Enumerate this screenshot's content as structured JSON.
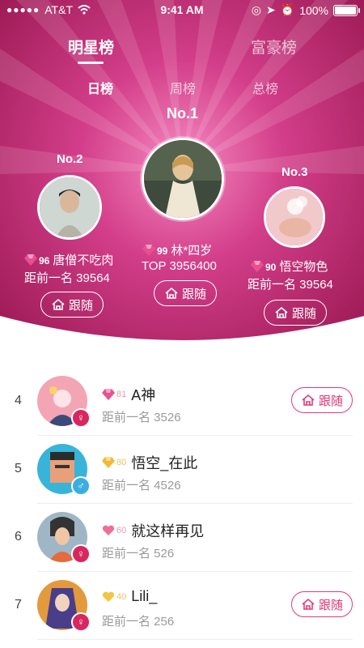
{
  "status": {
    "carrier": "AT&T",
    "time": "9:41 AM",
    "battery": "100%"
  },
  "tabs": {
    "main": [
      {
        "label": "明星榜",
        "active": true
      },
      {
        "label": "富豪榜",
        "active": false
      }
    ],
    "sub": [
      {
        "label": "日榜",
        "active": true
      },
      {
        "label": "周榜",
        "active": false
      },
      {
        "label": "总榜",
        "active": false
      }
    ]
  },
  "podium": {
    "first": {
      "rank": "No.1",
      "level": "99",
      "name": "林*四岁",
      "score_text": "TOP 3956400",
      "follow": "跟随"
    },
    "second": {
      "rank": "No.2",
      "level": "96",
      "name": "唐僧不吃肉",
      "score_text": "距前一名 39564",
      "follow": "跟随"
    },
    "third": {
      "rank": "No.3",
      "level": "90",
      "name": "悟空物色",
      "score_text": "距前一名 39564",
      "follow": "跟随"
    }
  },
  "list": [
    {
      "index": "4",
      "level": "81",
      "badge": "gem-pink",
      "name": "A神",
      "gap": "距前一名 3526",
      "gender": "female",
      "gender_glyph": "♀",
      "follow": "跟随",
      "show_follow": true
    },
    {
      "index": "5",
      "level": "80",
      "badge": "gem-gold",
      "name": "悟空_在此",
      "gap": "距前一名 4526",
      "gender": "male",
      "gender_glyph": "♂",
      "follow": "",
      "show_follow": false
    },
    {
      "index": "6",
      "level": "60",
      "badge": "heart-pink",
      "name": "就这样再见",
      "gap": "距前一名 526",
      "gender": "female",
      "gender_glyph": "♀",
      "follow": "",
      "show_follow": false
    },
    {
      "index": "7",
      "level": "40",
      "badge": "heart-gold",
      "name": "Lili_",
      "gap": "距前一名 256",
      "gender": "female",
      "gender_glyph": "♀",
      "follow": "跟随",
      "show_follow": true
    }
  ],
  "colors": {
    "accent": "#e0397a",
    "hero_dark": "#9e1450",
    "hero_light": "#f07fb8",
    "male": "#3aaee0",
    "female": "#d8265f"
  }
}
